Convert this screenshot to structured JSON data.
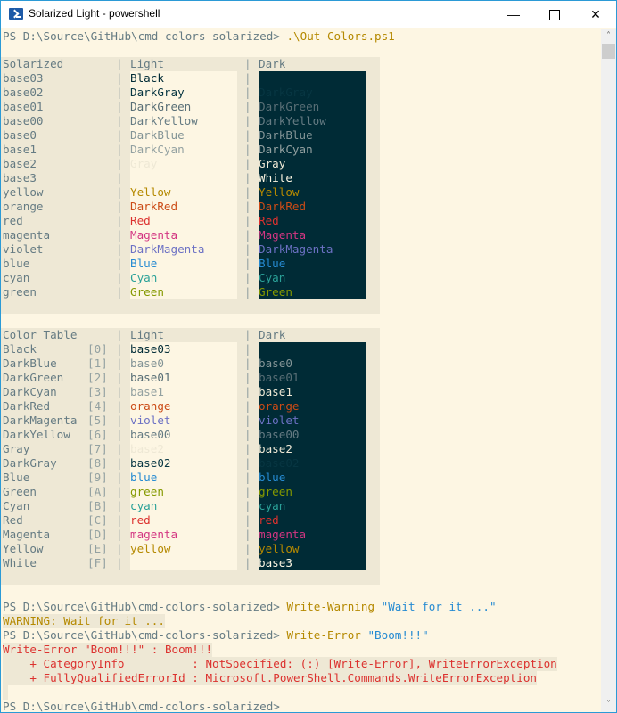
{
  "window": {
    "title": "Solarized Light - powershell",
    "controls": {
      "minimize": "—",
      "maximize": "",
      "close": "✕"
    }
  },
  "scrollbar": {
    "up_arrow": "˄",
    "down_arrow": "˅"
  },
  "prompt": "PS D:\\Source\\GitHub\\cmd-colors-solarized> ",
  "command1": ".\\Out-Colors.ps1",
  "table1": {
    "headers": {
      "col1": "Solarized",
      "col2": "Light",
      "col3": "Dark"
    },
    "separator": "|",
    "rows": [
      {
        "name": "base03",
        "light": "Black",
        "dark": "",
        "lc": "#002b36",
        "dc": "#002b36"
      },
      {
        "name": "base02",
        "light": "DarkGray",
        "dark": "DarkGray",
        "lc": "#073642",
        "dc": "#073642"
      },
      {
        "name": "base01",
        "light": "DarkGreen",
        "dark": "DarkGreen",
        "lc": "#586e75",
        "dc": "#586e75"
      },
      {
        "name": "base00",
        "light": "DarkYellow",
        "dark": "DarkYellow",
        "lc": "#657b83",
        "dc": "#657b83"
      },
      {
        "name": "base0",
        "light": "DarkBlue",
        "dark": "DarkBlue",
        "lc": "#839496",
        "dc": "#839496"
      },
      {
        "name": "base1",
        "light": "DarkCyan",
        "dark": "DarkCyan",
        "lc": "#93a1a1",
        "dc": "#93a1a1"
      },
      {
        "name": "base2",
        "light": "Gray",
        "dark": "Gray",
        "lc": "#eee8d5",
        "dc": "#eee8d5"
      },
      {
        "name": "base3",
        "light": "",
        "dark": "White",
        "lc": "#fdf6e3",
        "dc": "#fdf6e3"
      },
      {
        "name": "yellow",
        "light": "Yellow",
        "dark": "Yellow",
        "lc": "#b58900",
        "dc": "#b58900"
      },
      {
        "name": "orange",
        "light": "DarkRed",
        "dark": "DarkRed",
        "lc": "#cb4b16",
        "dc": "#cb4b16"
      },
      {
        "name": "red",
        "light": "Red",
        "dark": "Red",
        "lc": "#dc322f",
        "dc": "#dc322f"
      },
      {
        "name": "magenta",
        "light": "Magenta",
        "dark": "Magenta",
        "lc": "#d33682",
        "dc": "#d33682"
      },
      {
        "name": "violet",
        "light": "DarkMagenta",
        "dark": "DarkMagenta",
        "lc": "#6c71c4",
        "dc": "#6c71c4"
      },
      {
        "name": "blue",
        "light": "Blue",
        "dark": "Blue",
        "lc": "#268bd2",
        "dc": "#268bd2"
      },
      {
        "name": "cyan",
        "light": "Cyan",
        "dark": "Cyan",
        "lc": "#2aa198",
        "dc": "#2aa198"
      },
      {
        "name": "green",
        "light": "Green",
        "dark": "Green",
        "lc": "#859900",
        "dc": "#859900"
      }
    ]
  },
  "table2": {
    "headers": {
      "col1": "Color Table",
      "col2": "Light",
      "col3": "Dark"
    },
    "separator": "|",
    "rows": [
      {
        "name": "Black",
        "index": "[0]",
        "light": "base03",
        "dark": "",
        "lc": "#002b36",
        "dc": "#002b36"
      },
      {
        "name": "DarkBlue",
        "index": "[1]",
        "light": "base0",
        "dark": "base0",
        "lc": "#839496",
        "dc": "#839496"
      },
      {
        "name": "DarkGreen",
        "index": "[2]",
        "light": "base01",
        "dark": "base01",
        "lc": "#586e75",
        "dc": "#586e75"
      },
      {
        "name": "DarkCyan",
        "index": "[3]",
        "light": "base1",
        "dark": "base1",
        "lc": "#93a1a1",
        "dc": "#eee8d5"
      },
      {
        "name": "DarkRed",
        "index": "[4]",
        "light": "orange",
        "dark": "orange",
        "lc": "#cb4b16",
        "dc": "#cb4b16"
      },
      {
        "name": "DarkMagenta",
        "index": "[5]",
        "light": "violet",
        "dark": "violet",
        "lc": "#6c71c4",
        "dc": "#6c71c4"
      },
      {
        "name": "DarkYellow",
        "index": "[6]",
        "light": "base00",
        "dark": "base00",
        "lc": "#657b83",
        "dc": "#657b83"
      },
      {
        "name": "Gray",
        "index": "[7]",
        "light": "base2",
        "dark": "base2",
        "lc": "#eee8d5",
        "dc": "#eee8d5"
      },
      {
        "name": "DarkGray",
        "index": "[8]",
        "light": "base02",
        "dark": "base02",
        "lc": "#073642",
        "dc": "#073642"
      },
      {
        "name": "Blue",
        "index": "[9]",
        "light": "blue",
        "dark": "blue",
        "lc": "#268bd2",
        "dc": "#268bd2"
      },
      {
        "name": "Green",
        "index": "[A]",
        "light": "green",
        "dark": "green",
        "lc": "#859900",
        "dc": "#859900"
      },
      {
        "name": "Cyan",
        "index": "[B]",
        "light": "cyan",
        "dark": "cyan",
        "lc": "#2aa198",
        "dc": "#2aa198"
      },
      {
        "name": "Red",
        "index": "[C]",
        "light": "red",
        "dark": "red",
        "lc": "#dc322f",
        "dc": "#dc322f"
      },
      {
        "name": "Magenta",
        "index": "[D]",
        "light": "magenta",
        "dark": "magenta",
        "lc": "#d33682",
        "dc": "#d33682"
      },
      {
        "name": "Yellow",
        "index": "[E]",
        "light": "yellow",
        "dark": "yellow",
        "lc": "#b58900",
        "dc": "#b58900"
      },
      {
        "name": "White",
        "index": "[F]",
        "light": "",
        "dark": "base3",
        "lc": "#fdf6e3",
        "dc": "#fdf6e3"
      }
    ]
  },
  "command2": {
    "cmdlet": "Write-Warning",
    "arg": "\"Wait for it ...\""
  },
  "warning_output": "WARNING: Wait for it ...",
  "command3": {
    "cmdlet": "Write-Error",
    "arg": "\"Boom!!!\""
  },
  "error_output": [
    "Write-Error \"Boom!!!\" : Boom!!!",
    "    + CategoryInfo          : NotSpecified: (:) [Write-Error], WriteErrorException",
    "    + FullyQualifiedErrorId : Microsoft.PowerShell.Commands.WriteErrorException"
  ],
  "colors": {
    "background": "#fdf6e3",
    "panel": "#eee8d5",
    "dark_bg": "#002b36",
    "label": "#657b83",
    "separator": "#93a1a1",
    "warning": "#b58900",
    "error": "#dc322f"
  }
}
